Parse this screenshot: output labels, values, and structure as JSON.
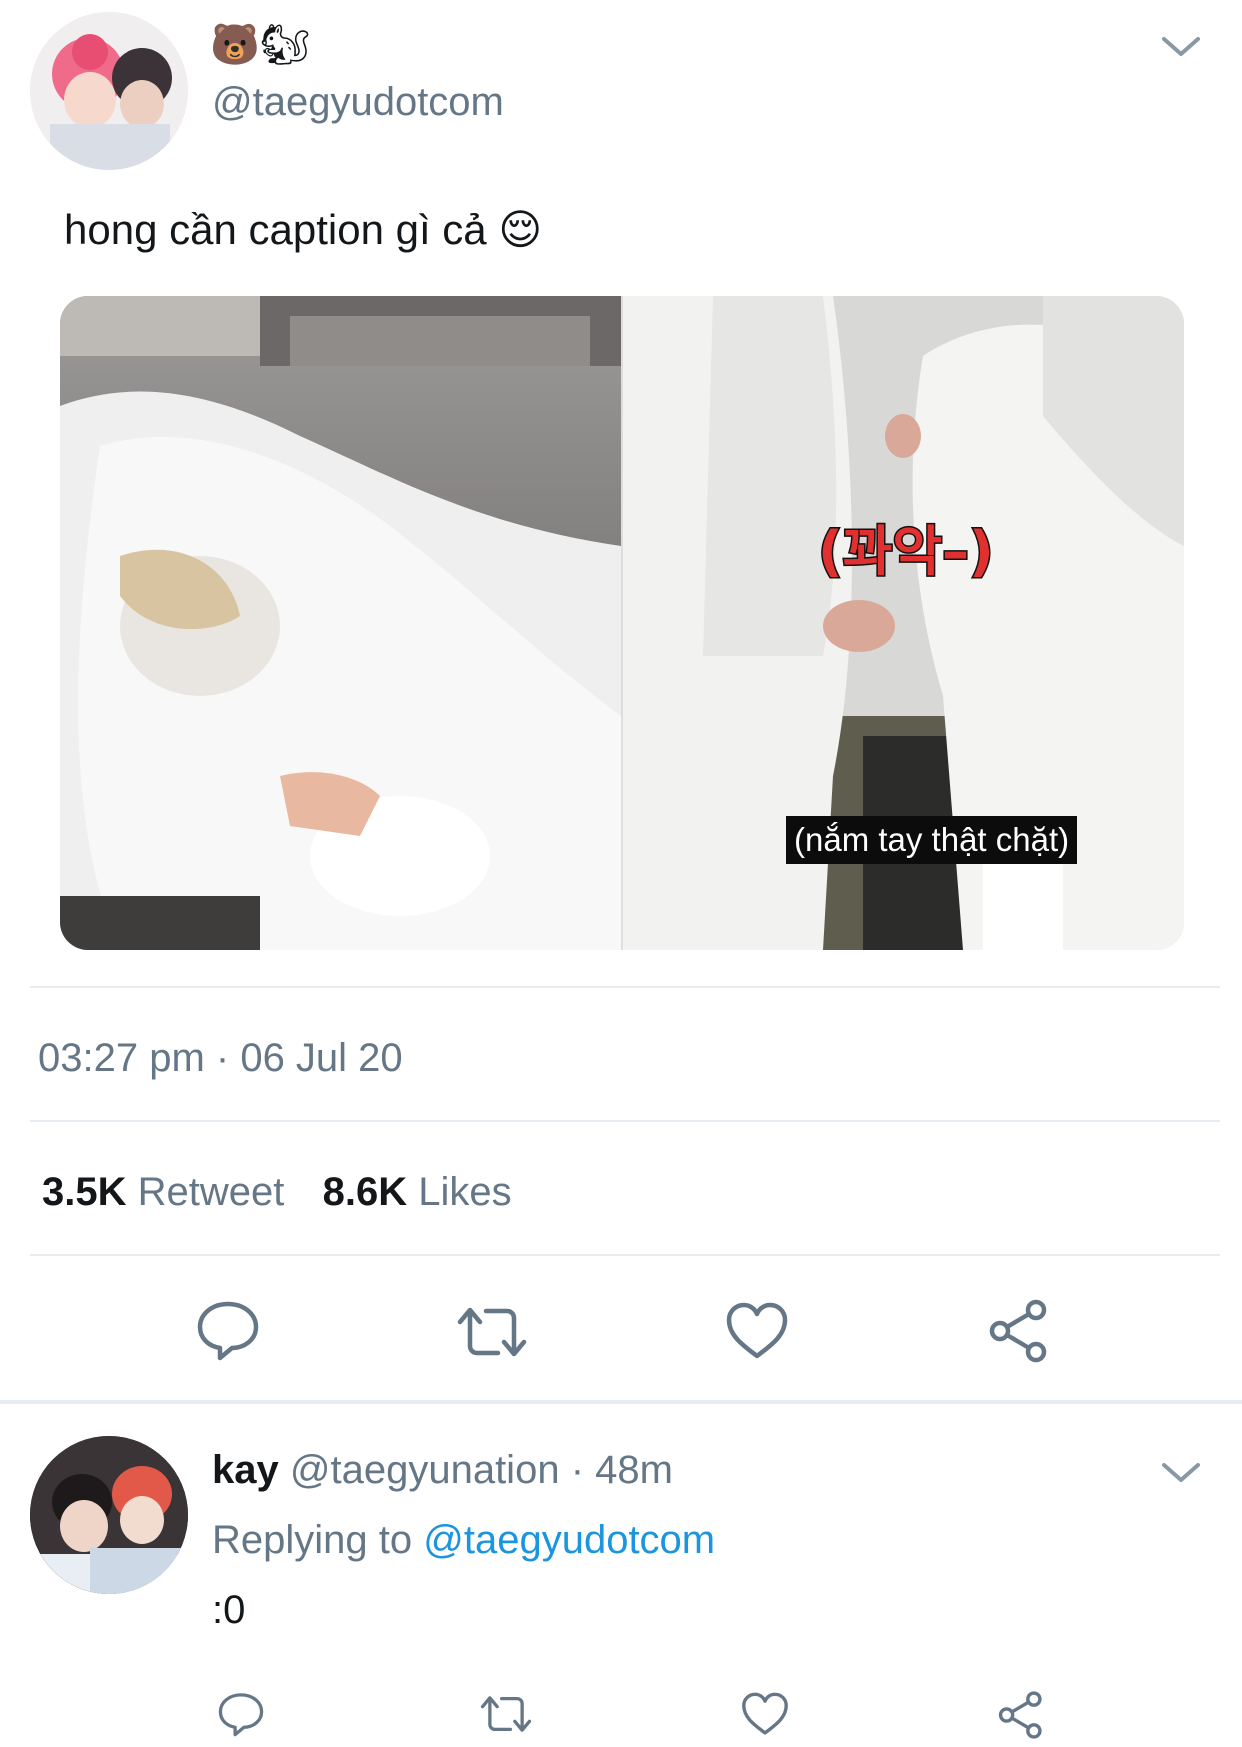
{
  "tweet": {
    "display_name_emoji": "🐻🐿",
    "handle": "@taegyudotcom",
    "text": "hong cần caption gì cả",
    "text_emoji": "😌",
    "media": {
      "left_caption": "",
      "right_korean_caption": "(꽈악–)",
      "right_caption": "(nắm tay thật chặt)"
    },
    "timestamp": "03:27 pm · 06 Jul 20",
    "stats": {
      "retweets_count": "3.5K",
      "retweets_label": "Retweet",
      "likes_count": "8.6K",
      "likes_label": "Likes"
    },
    "icons": [
      "reply-icon",
      "retweet-icon",
      "like-icon",
      "share-icon"
    ]
  },
  "reply": {
    "name": "kay",
    "handle": "@taegyunation",
    "time": "· 48m",
    "replying_to_label": "Replying to",
    "replying_to_handle": "@taegyudotcom",
    "text": ":0"
  },
  "colors": {
    "muted": "#657786",
    "link": "#1b95e0",
    "divider": "#e6ecf0",
    "caption_red": "#e0302f"
  }
}
